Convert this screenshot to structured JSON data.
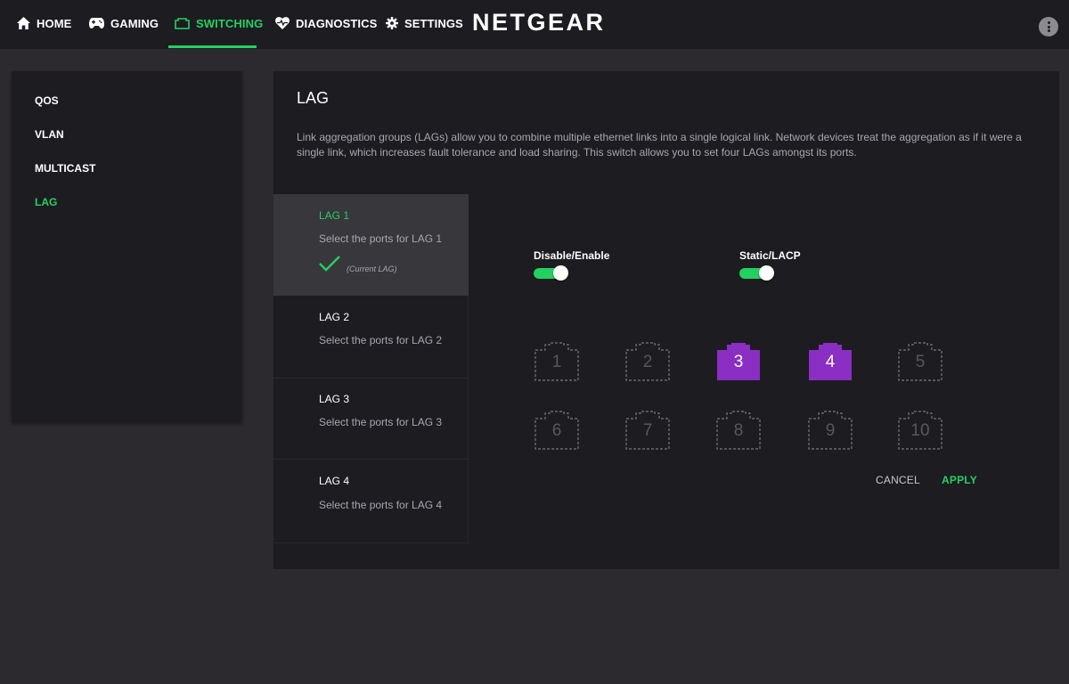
{
  "nav": {
    "items": [
      {
        "label": "HOME",
        "icon": "home-icon"
      },
      {
        "label": "GAMING",
        "icon": "gamepad-icon"
      },
      {
        "label": "SWITCHING",
        "icon": "switch-icon",
        "active": true
      },
      {
        "label": "DIAGNOSTICS",
        "icon": "heart-pulse-icon"
      },
      {
        "label": "SETTINGS",
        "icon": "gear-icon"
      }
    ],
    "brand": "NETGEAR",
    "menu_icon": "more-vertical-icon"
  },
  "sidebar": {
    "items": [
      {
        "label": "QOS"
      },
      {
        "label": "VLAN"
      },
      {
        "label": "MULTICAST"
      },
      {
        "label": "LAG",
        "active": true
      }
    ]
  },
  "main": {
    "title": "LAG",
    "description": "Link aggregation groups (LAGs) allow you to combine multiple ethernet links into a single logical link. Network devices treat the aggregation as if it were a single link, which increases fault tolerance and load sharing. This switch allows you to set four LAGs amongst its ports.",
    "lags": [
      {
        "name": "LAG 1",
        "subtitle": "Select the ports for LAG 1",
        "current_label": "(Current LAG)",
        "selected": true
      },
      {
        "name": "LAG 2",
        "subtitle": "Select the ports for LAG 2"
      },
      {
        "name": "LAG 3",
        "subtitle": "Select the ports for LAG 3"
      },
      {
        "name": "LAG 4",
        "subtitle": "Select the ports for LAG 4"
      }
    ],
    "toggles": {
      "enable": {
        "label": "Disable/Enable",
        "on": true
      },
      "mode": {
        "label": "Static/LACP",
        "on": true
      }
    },
    "ports": [
      {
        "number": "1",
        "selected": false
      },
      {
        "number": "2",
        "selected": false
      },
      {
        "number": "3",
        "selected": true
      },
      {
        "number": "4",
        "selected": true
      },
      {
        "number": "5",
        "selected": false
      },
      {
        "number": "6",
        "selected": false
      },
      {
        "number": "7",
        "selected": false
      },
      {
        "number": "8",
        "selected": false
      },
      {
        "number": "9",
        "selected": false
      },
      {
        "number": "10",
        "selected": false
      }
    ],
    "cancel_label": "CANCEL",
    "apply_label": "APPLY"
  },
  "colors": {
    "accent": "#23d160",
    "port_selected": "#8a2ec4",
    "port_outline": "#6a696e",
    "panel": "#1d1c21",
    "background": "#2c2a2e"
  }
}
